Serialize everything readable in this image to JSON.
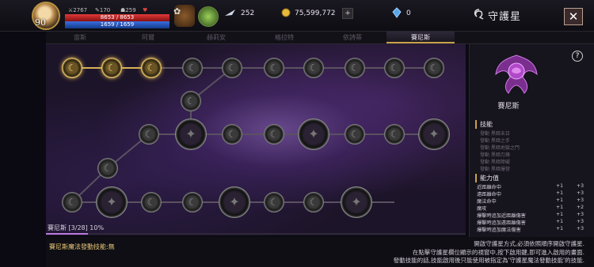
{
  "header": {
    "level": "90",
    "combat_power": "2767",
    "stat_a": "170",
    "stat_b": "259",
    "hp": "8653 / 8653",
    "mp": "1659 / 1659",
    "hp_fraction": 1.0,
    "mp_fraction": 1.0,
    "feather_count": "252",
    "gold": "75,599,772",
    "crystal": "0",
    "title": "守護星",
    "plus_label": "+",
    "close_label": "✕"
  },
  "tabs": [
    {
      "label": "宙斯",
      "active": false
    },
    {
      "label": "阿爾",
      "active": false
    },
    {
      "label": "赫莉安",
      "active": false
    },
    {
      "label": "格拉特",
      "active": false
    },
    {
      "label": "依詩蒂",
      "active": false
    },
    {
      "label": "賽尼斯",
      "active": true
    }
  ],
  "progress": {
    "label": "賽尼斯 [3/28] 10%",
    "fraction": 0.1
  },
  "skill_info": "賽尼斯魔法發動技能:無",
  "help_text": [
    "開啟守護星方式,必須依照順序開啟守護星.",
    "在點擊守護星欄位顯示的視窗中,按下啟用鍵,即可進入啟用的畫面.",
    "發動技能的話,技能啟用後只能使用被指定為'守護星魔法發動技能'的技能."
  ],
  "panel": {
    "help_label": "?",
    "name": "賽尼斯",
    "skills_title": "技能",
    "skills": [
      "發動 黑暗末日",
      "發動 黑暗之手",
      "發動 黑暗地獄之門",
      "發動 黑暗刃鋒",
      "發動 黑暗障礙",
      "發動 黑暗爆發"
    ],
    "abilities_title": "能力值",
    "abilities": [
      {
        "name": "近距離命中",
        "v1": "+1",
        "v2": "+3"
      },
      {
        "name": "遠距離命中",
        "v1": "+1",
        "v2": "+3"
      },
      {
        "name": "魔法命中",
        "v1": "+1",
        "v2": "+3"
      },
      {
        "name": "魔攻",
        "v1": "+1",
        "v2": "+2"
      },
      {
        "name": "爆擊時追加近距離傷害",
        "v1": "+1",
        "v2": "+3"
      },
      {
        "name": "爆擊時追加遠距離傷害",
        "v1": "+1",
        "v2": "+3"
      },
      {
        "name": "爆擊時追加魔法傷害",
        "v1": "+1",
        "v2": "+3"
      }
    ]
  },
  "nodes": {
    "lit_count": 3,
    "small_glyph": "☾",
    "big_glyph": "✦"
  }
}
